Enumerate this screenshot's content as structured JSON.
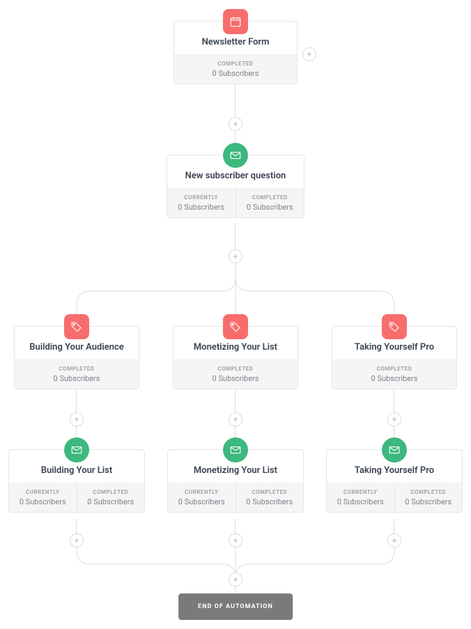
{
  "nodes": {
    "form": {
      "title": "Newsletter Form",
      "completed_lbl": "COMPLETED",
      "completed_val": "0 Subscribers"
    },
    "question": {
      "title": "New subscriber question",
      "curr_lbl": "CURRENTLY",
      "curr_val": "0 Subscribers",
      "comp_lbl": "COMPLETED",
      "comp_val": "0 Subscribers"
    },
    "tagA": {
      "title": "Building Your Audience",
      "completed_lbl": "COMPLETED",
      "completed_val": "0 Subscribers"
    },
    "tagB": {
      "title": "Monetizing Your List",
      "completed_lbl": "COMPLETED",
      "completed_val": "0 Subscribers"
    },
    "tagC": {
      "title": "Taking Yourself Pro",
      "completed_lbl": "COMPLETED",
      "completed_val": "0 Subscribers"
    },
    "mailA": {
      "title": "Building Your List",
      "curr_lbl": "CURRENTLY",
      "curr_val": "0 Subscribers",
      "comp_lbl": "COMPLETED",
      "comp_val": "0 Subscribers"
    },
    "mailB": {
      "title": "Monetizing Your List",
      "curr_lbl": "CURRENTLY",
      "curr_val": "0 Subscribers",
      "comp_lbl": "COMPLETED",
      "comp_val": "0 Subscribers"
    },
    "mailC": {
      "title": "Taking Yourself Pro",
      "curr_lbl": "CURRENTLY",
      "curr_val": "0 Subscribers",
      "comp_lbl": "COMPLETED",
      "comp_val": "0 Subscribers"
    }
  },
  "end_label": "END OF AUTOMATION",
  "plus": "+"
}
